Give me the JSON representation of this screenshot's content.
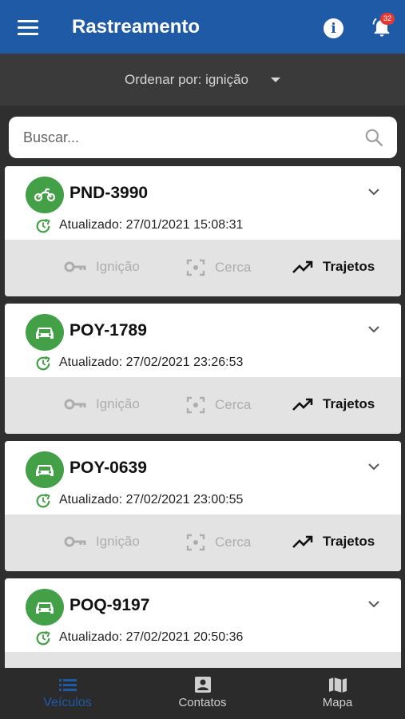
{
  "appbar": {
    "title": "Rastreamento",
    "info_glyph": "i",
    "notification_count": "32",
    "icons": [
      "menu-icon",
      "info-icon",
      "bell-icon"
    ]
  },
  "sort": {
    "label": "Ordenar por: ignição"
  },
  "search": {
    "placeholder": "Buscar...",
    "value": ""
  },
  "vehicles": [
    {
      "plate": "PND-3990",
      "type": "motorcycle",
      "updated": "Atualizado: 27/01/2021 15:08:31"
    },
    {
      "plate": "POY-1789",
      "type": "car",
      "updated": "Atualizado: 27/02/2021 23:26:53"
    },
    {
      "plate": "POY-0639",
      "type": "car",
      "updated": "Atualizado: 27/02/2021 23:00:55"
    },
    {
      "plate": "POQ-9197",
      "type": "car",
      "updated": "Atualizado: 27/02/2021 20:50:36"
    }
  ],
  "actions": {
    "ignicao": "Ignição",
    "cerca": "Cerca",
    "trajetos": "Trajetos"
  },
  "nav": {
    "veiculos": "Veículos",
    "contatos": "Contatos",
    "mapa": "Mapa"
  },
  "colors": {
    "primary": "#1f5aa6",
    "vehicle_online": "#43a047",
    "badge": "#e53935",
    "disabled": "#adadad"
  }
}
